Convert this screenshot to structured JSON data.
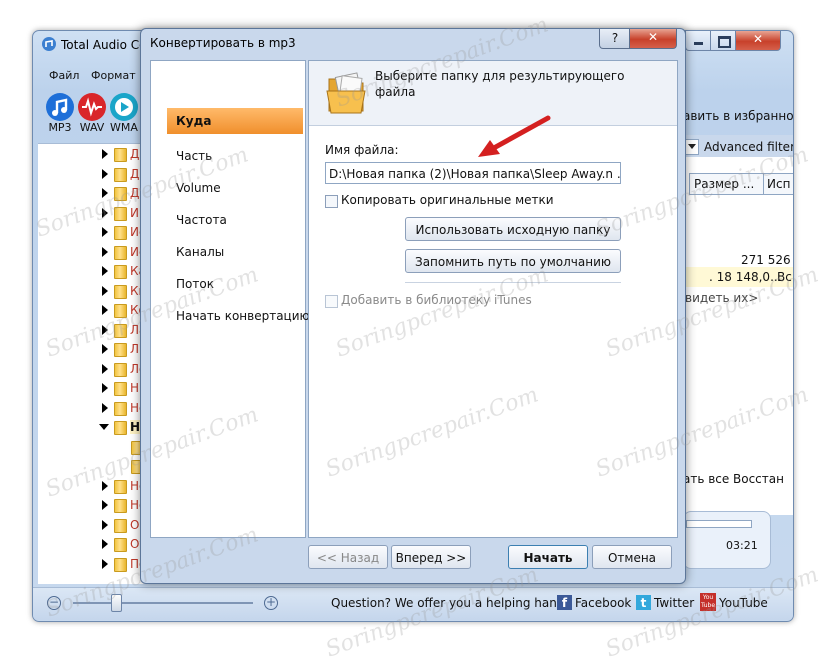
{
  "app": {
    "title": "Total Audio Co",
    "menu": [
      "Файл",
      "Формат"
    ],
    "formats": [
      {
        "label": "MP3",
        "color": "#1e6fd8"
      },
      {
        "label": "WAV",
        "color": "#d9262a"
      },
      {
        "label": "WMA",
        "color": "#1aa5c9"
      }
    ],
    "tree_items": [
      {
        "text": "Дж",
        "expanded": false
      },
      {
        "text": "Дж",
        "expanded": false
      },
      {
        "text": "Др",
        "expanded": false
      },
      {
        "text": "ИГ",
        "expanded": false
      },
      {
        "text": "Ис",
        "expanded": false
      },
      {
        "text": "Ис",
        "expanded": false
      },
      {
        "text": "Ка",
        "expanded": false
      },
      {
        "text": "Кн",
        "expanded": false
      },
      {
        "text": "Ко",
        "expanded": false
      },
      {
        "text": "Ла",
        "expanded": false
      },
      {
        "text": "Ли",
        "expanded": false
      },
      {
        "text": "Ло",
        "expanded": false
      },
      {
        "text": "Ни",
        "expanded": false
      },
      {
        "text": "Но",
        "expanded": false
      },
      {
        "text": "Но",
        "expanded": true
      },
      {
        "text": "",
        "child": true
      },
      {
        "text": "",
        "child": true
      },
      {
        "text": "Но",
        "expanded": false
      },
      {
        "text": "Но",
        "expanded": false
      },
      {
        "text": "Оп",
        "expanded": false
      },
      {
        "text": "От",
        "expanded": false
      },
      {
        "text": "По",
        "expanded": false
      }
    ],
    "right": {
      "favorites": "авить в избранное",
      "filter": "Advanced filter",
      "col_size": "Размер ...",
      "col_other": "Исп",
      "size_value": "271 526",
      "row2_value": ". 18 148,0...",
      "row2_extra": "Вс",
      "see_them": "видеть их>",
      "select_all": "ать все",
      "restore": "Восстан",
      "time": "03:21"
    },
    "status": {
      "question": "Question? We offer you a helping hand -",
      "facebook": "Facebook",
      "twitter": "Twitter",
      "youtube": "YouTube",
      "youtube_badge": "You Tube"
    }
  },
  "dialog": {
    "title": "Конвертировать в mp3",
    "help_label": "?",
    "close_label": "✕",
    "nav": [
      "Куда",
      "Часть",
      "Volume",
      "Частота",
      "Каналы",
      "Поток",
      "Начать конвертацию"
    ],
    "active_nav": 0,
    "header_text": "Выберите папку для результирующего файла",
    "filename_label": "Имя файла:",
    "filename_value": "D:\\Новая папка (2)\\Новая папка\\Sleep Away.n ...",
    "copy_tags_label": "Копировать оригинальные метки",
    "copy_tags_checked": false,
    "use_source_button": "Использовать исходную папку",
    "remember_button": "Запомнить путь по умолчанию",
    "itunes_label": "Добавить в библиотеку iTunes",
    "itunes_checked": false,
    "itunes_disabled": true,
    "back_button": "<< Назад",
    "next_button": "Вперед >>",
    "start_button": "Начать",
    "cancel_button": "Отмена"
  },
  "watermark": "Soringpcrepair.Com",
  "colors": {
    "active_nav": "#f5a04a",
    "arrow": "#d42020",
    "tree_text": "#c0392b"
  }
}
